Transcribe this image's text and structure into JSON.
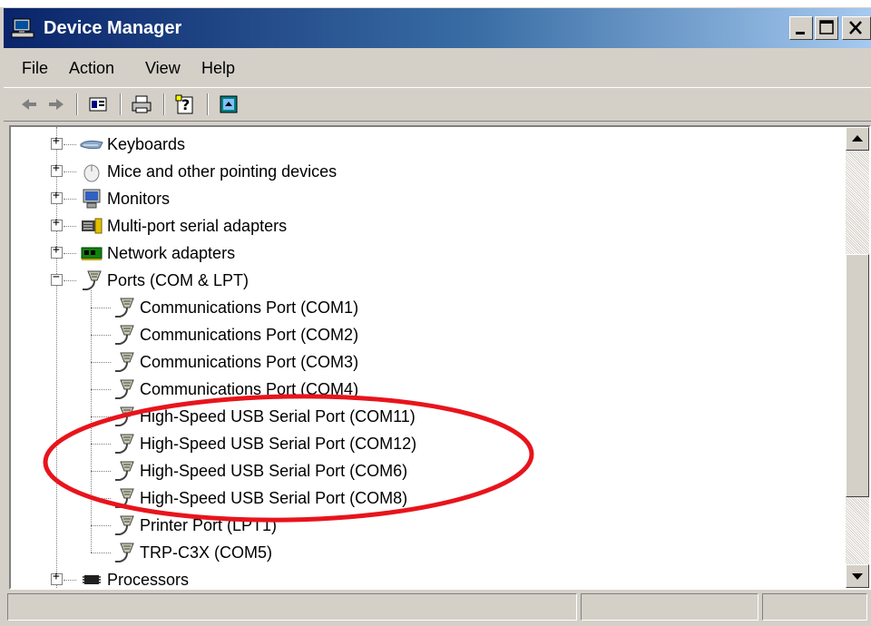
{
  "window": {
    "title": "Device Manager",
    "controls": [
      "minimize",
      "maximize",
      "close"
    ]
  },
  "menu": [
    "File",
    "Action",
    "View",
    "Help"
  ],
  "toolbar": [
    "back-icon",
    "forward-icon",
    "properties-icon",
    "print-icon",
    "help-icon",
    "scan-icon"
  ],
  "tree": {
    "categories_before": [
      {
        "label": "Keyboards",
        "icon": "keyboard-icon"
      },
      {
        "label": "Mice and other pointing devices",
        "icon": "mouse-icon"
      },
      {
        "label": "Monitors",
        "icon": "monitor-icon"
      },
      {
        "label": "Multi-port serial adapters",
        "icon": "serial-adapter-icon"
      },
      {
        "label": "Network adapters",
        "icon": "network-adapter-icon"
      }
    ],
    "ports": {
      "label": "Ports (COM & LPT)",
      "icon": "port-icon",
      "children": [
        "Communications Port (COM1)",
        "Communications Port (COM2)",
        "Communications Port (COM3)",
        "Communications Port (COM4)",
        "High-Speed USB Serial Port (COM11)",
        "High-Speed USB Serial Port (COM12)",
        "High-Speed USB Serial Port (COM6)",
        "High-Speed USB Serial Port (COM8)",
        "Printer Port (LPT1)",
        "TRP-C3X (COM5)"
      ]
    },
    "categories_after": [
      {
        "label": "Processors",
        "icon": "processor-icon"
      }
    ]
  },
  "colors": {
    "annotation": "#e8141c",
    "titlebar": "#0a246a"
  }
}
